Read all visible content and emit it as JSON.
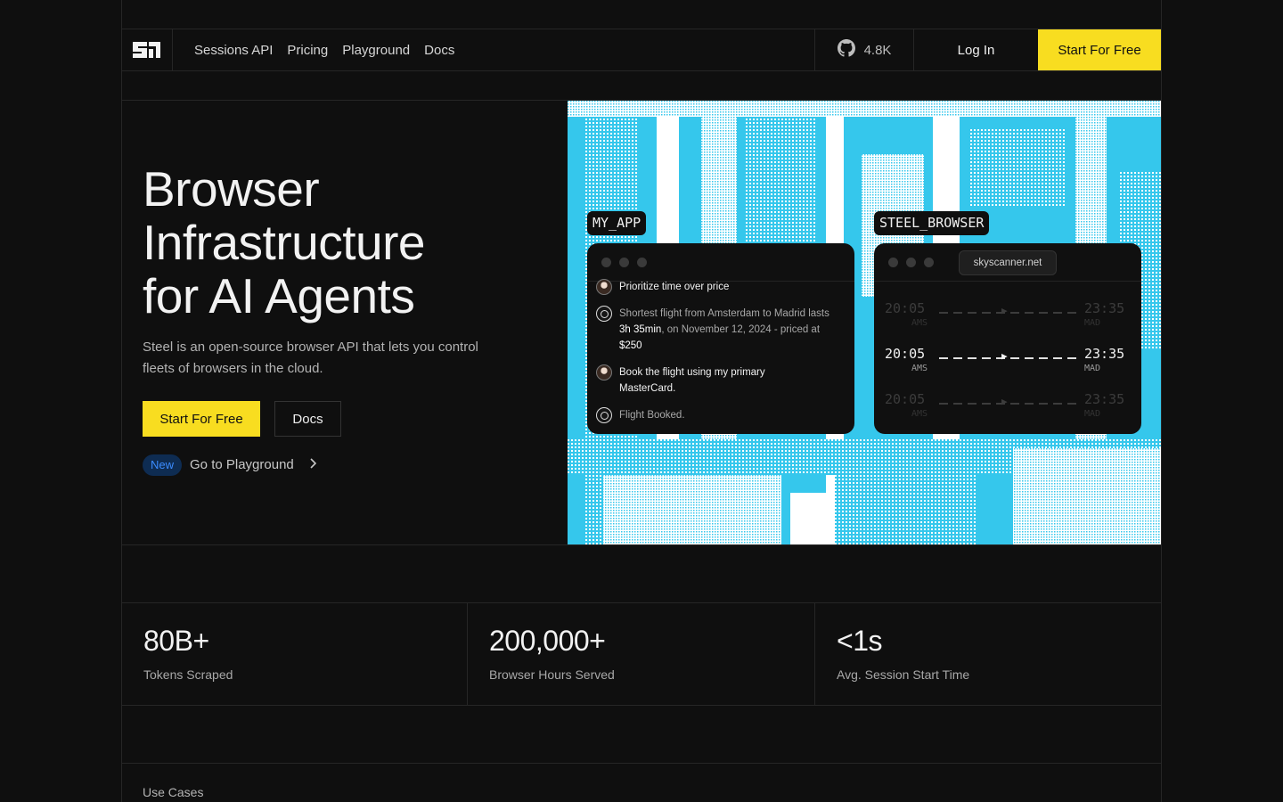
{
  "nav": {
    "links": [
      "Sessions API",
      "Pricing",
      "Playground",
      "Docs"
    ],
    "github_stars": "4.8K",
    "login": "Log In",
    "cta": "Start For Free"
  },
  "hero": {
    "title_lines": [
      "Browser",
      "Infrastructure",
      "for AI Agents"
    ],
    "subtitle": "Steel is an open-source browser API that lets you control fleets of browsers in the cloud.",
    "primary_button": "Start For Free",
    "secondary_button": "Docs",
    "badge": "New",
    "playground_link": "Go to Playground"
  },
  "demo": {
    "app_tag": "MY_APP",
    "browser_tag": "STEEL_BROWSER",
    "url": "skyscanner.net",
    "chat": {
      "m1": "Prioritize time over price",
      "m2_pre": "Shortest flight from Amsterdam to Madrid lasts ",
      "m2_b1": "3h 35min",
      "m2_mid": ", on November 12, 2024 - priced at ",
      "m2_b2": "$250",
      "m3": "Book the flight using my primary MasterCard.",
      "m4": "Flight Booked."
    },
    "flights": [
      {
        "dep": "20:05",
        "from": "AMS",
        "arr": "23:35",
        "to": "MAD"
      },
      {
        "dep": "20:05",
        "from": "AMS",
        "arr": "23:35",
        "to": "MAD"
      },
      {
        "dep": "20:05",
        "from": "AMS",
        "arr": "23:35",
        "to": "MAD"
      }
    ]
  },
  "stats": [
    {
      "value": "80B+",
      "label": "Tokens Scraped"
    },
    {
      "value": "200,000+",
      "label": "Browser Hours Served"
    },
    {
      "value": "<1s",
      "label": "Avg. Session Start Time"
    }
  ],
  "section_label": "Use Cases",
  "colors": {
    "background": "#0f0f0f",
    "accent_yellow": "#f8dd20",
    "art_cyan": "#35c7ec",
    "badge_blue": "#3b8cff"
  },
  "icons": [
    "steel-logo-icon",
    "github-icon",
    "chevron-right-icon",
    "user-avatar-icon",
    "openai-icon"
  ]
}
